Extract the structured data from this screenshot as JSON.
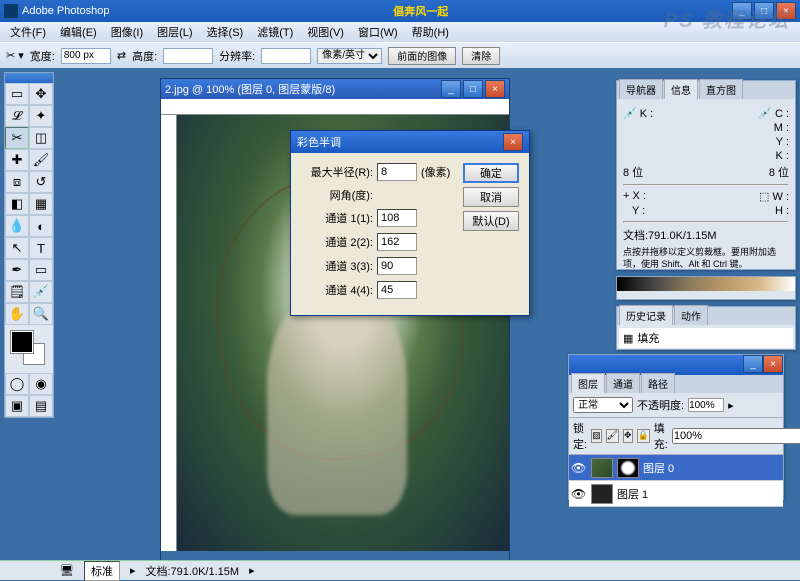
{
  "app": {
    "title": "Adobe Photoshop",
    "center_title": "倡奔风一起"
  },
  "menu": [
    "文件(F)",
    "编辑(E)",
    "图像(I)",
    "图层(L)",
    "选择(S)",
    "滤镜(T)",
    "视图(V)",
    "窗口(W)",
    "帮助(H)"
  ],
  "options": {
    "width_label": "宽度:",
    "width": "800 px",
    "height_label": "高度:",
    "res_label": "分辨率:",
    "unit": "像素/英寸",
    "btn1": "前面的图像",
    "btn2": "清除"
  },
  "doc": {
    "title": "2.jpg @ 100% (图层 0, 图层蒙版/8)"
  },
  "dialog": {
    "title": "彩色半调",
    "radius_label": "最大半径(R):",
    "radius": "8",
    "radius_unit": "(像素)",
    "angle_label": "网角(度):",
    "ch1_label": "通道 1(1):",
    "ch1": "108",
    "ch2_label": "通道 2(2):",
    "ch2": "162",
    "ch3_label": "通道 3(3):",
    "ch3": "90",
    "ch4_label": "通道 4(4):",
    "ch4": "45",
    "ok": "确定",
    "cancel": "取消",
    "defaults": "默认(D)"
  },
  "info": {
    "tabs": [
      "导航器",
      "信息",
      "直方图"
    ],
    "k": "K :",
    "c": "C :",
    "m": "M :",
    "y": "Y :",
    "kk": "K :",
    "bit": "8 位",
    "x": "X :",
    "yy": "Y :",
    "w": "W :",
    "h": "H :",
    "docsize": "文档:791.0K/1.15M",
    "hint": "点按并拖移以定义剪裁框。要用附加选项，使用 Shift、Alt 和 Ctrl 键。"
  },
  "history": {
    "tabs": [
      "历史记录",
      "动作"
    ],
    "item": "填充"
  },
  "layers": {
    "tabs": [
      "图层",
      "通道",
      "路径"
    ],
    "blend": "正常",
    "opacity_label": "不透明度:",
    "opacity": "100%",
    "lock_label": "锁定:",
    "fill_label": "填充:",
    "fill": "100%",
    "layer0": "图层 0",
    "layer1": "图层 1"
  },
  "status": {
    "zoom": "标准",
    "doc": "文档:791.0K/1.15M"
  },
  "watermark": "PS 教程论坛"
}
